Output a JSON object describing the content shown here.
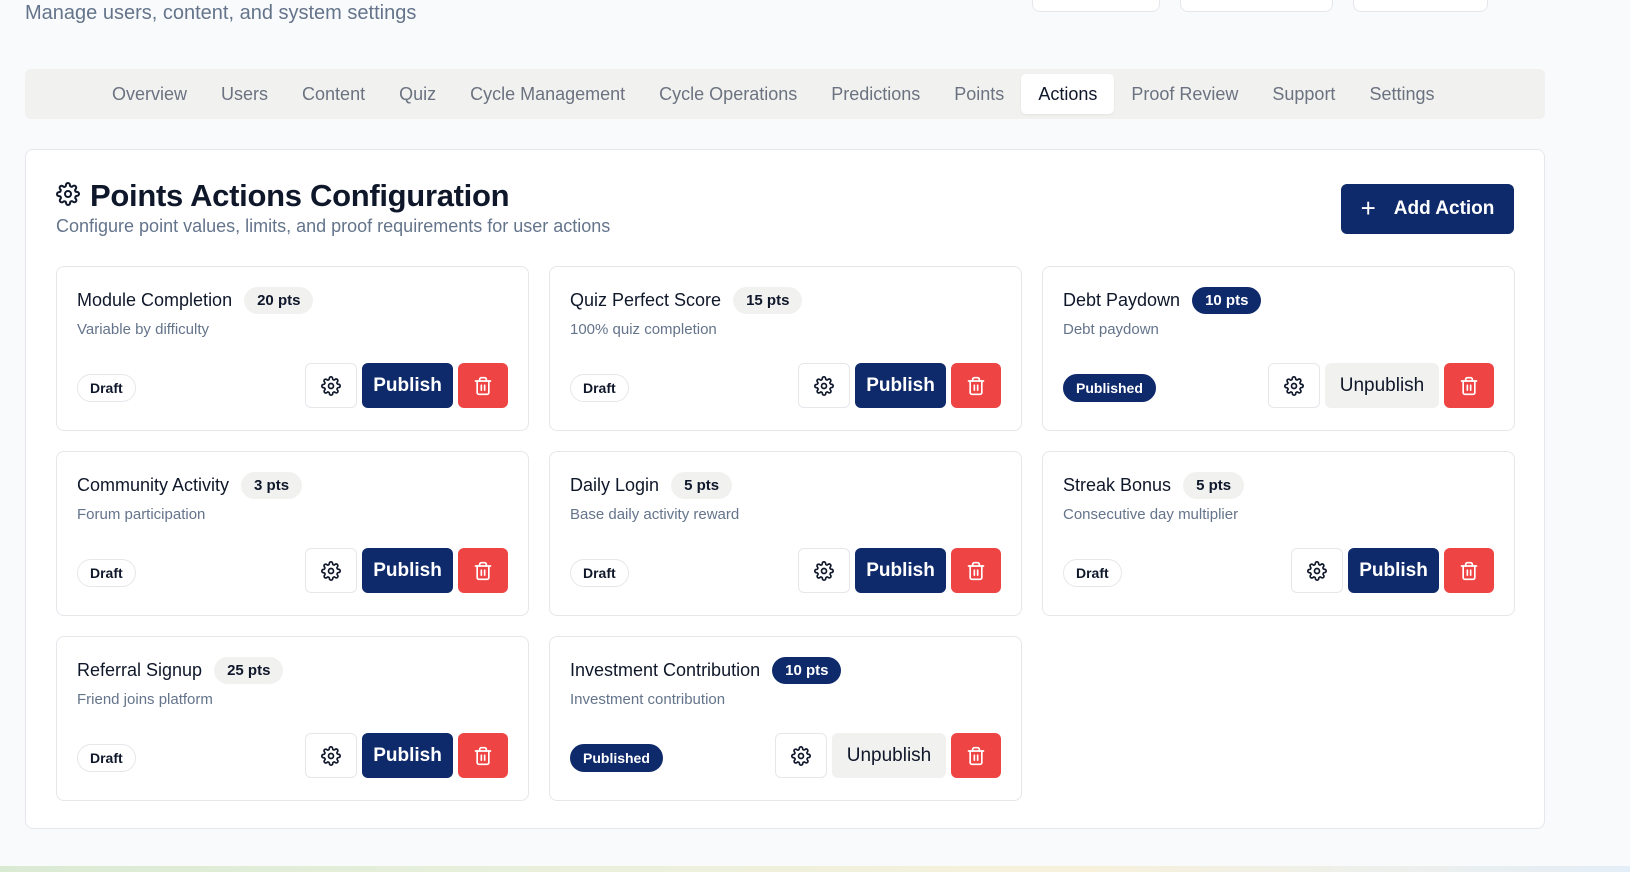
{
  "header": {
    "subtitle": "Manage users, content, and system settings"
  },
  "tabs": [
    {
      "label": "Overview"
    },
    {
      "label": "Users"
    },
    {
      "label": "Content"
    },
    {
      "label": "Quiz"
    },
    {
      "label": "Cycle Management"
    },
    {
      "label": "Cycle Operations"
    },
    {
      "label": "Predictions"
    },
    {
      "label": "Points"
    },
    {
      "label": "Actions",
      "active": true
    },
    {
      "label": "Proof Review"
    },
    {
      "label": "Support"
    },
    {
      "label": "Settings"
    }
  ],
  "panel": {
    "title": "Points Actions Configuration",
    "description": "Configure point values, limits, and proof requirements for user actions",
    "add_button_label": "Add Action",
    "title_icon": "gear-icon"
  },
  "cards": [
    {
      "name": "Module Completion",
      "points": "20 pts",
      "description": "Variable by difficulty",
      "status": "Draft",
      "action_label": "Publish",
      "published": false
    },
    {
      "name": "Quiz Perfect Score",
      "points": "15 pts",
      "description": "100% quiz completion",
      "status": "Draft",
      "action_label": "Publish",
      "published": false
    },
    {
      "name": "Debt Paydown",
      "points": "10 pts",
      "description": "Debt paydown",
      "status": "Published",
      "action_label": "Unpublish",
      "published": true
    },
    {
      "name": "Community Activity",
      "points": "3 pts",
      "description": "Forum participation",
      "status": "Draft",
      "action_label": "Publish",
      "published": false
    },
    {
      "name": "Daily Login",
      "points": "5 pts",
      "description": "Base daily activity reward",
      "status": "Draft",
      "action_label": "Publish",
      "published": false
    },
    {
      "name": "Streak Bonus",
      "points": "5 pts",
      "description": "Consecutive day multiplier",
      "status": "Draft",
      "action_label": "Publish",
      "published": false
    },
    {
      "name": "Referral Signup",
      "points": "25 pts",
      "description": "Friend joins platform",
      "status": "Draft",
      "action_label": "Publish",
      "published": false
    },
    {
      "name": "Investment Contribution",
      "points": "10 pts",
      "description": "Investment contribution",
      "status": "Published",
      "action_label": "Unpublish",
      "published": true
    }
  ],
  "colors": {
    "primary": "#0f2a6b",
    "danger": "#ef4444",
    "muted_bg": "#f1f1ef"
  }
}
